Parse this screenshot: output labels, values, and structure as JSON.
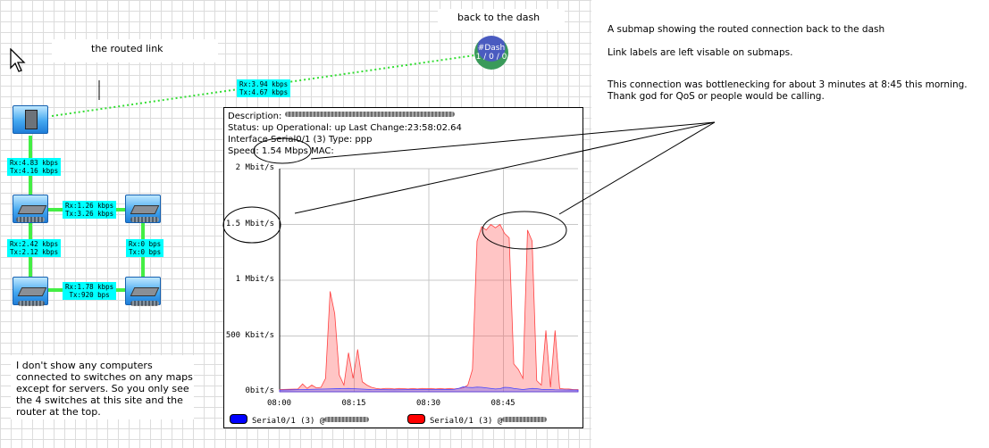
{
  "notes": {
    "routed_link": "the routed link",
    "back_to_dash": "back to the dash",
    "bottom": "I don't show any computers connected to switches on any maps except for servers.  So you only see the 4 switches at this site and the router at the top.",
    "right_1": "A submap showing the routed connection back to the dash",
    "right_2": "Link labels are left visable on submaps.",
    "right_3": "This connection was bottlenecking for about 3 minutes at 8:45 this morning.  Thank god for QoS or people would be calling."
  },
  "dash_node": {
    "name": "#Dash",
    "status": "1 / 0 / 0"
  },
  "links": {
    "routed": "Rx:3.94 kbps\nTx:4.67 kbps",
    "router_sw1": "Rx:4.83 kbps\nTx:4.16 kbps",
    "sw1_sw2": "Rx:1.26 kbps\nTx:3.26 kbps",
    "sw1_sw3": "Rx:2.42 kbps\nTx:2.12 kbps",
    "sw2_sw4": "Rx:0 bps\nTx:0 bps",
    "sw3_sw4": "Rx:1.78 kbps\nTx:920 bps"
  },
  "graph": {
    "description_label": "Description:",
    "status": "Status: up Operational: up  Last Change:23:58:02.64",
    "interface": "Interface Serial0/1 (3)   Type: ppp",
    "speed_label": "Speed:",
    "speed_value": "1.54 Mbps",
    "mac_label": "MAC:",
    "legend_blue": "Serial0/1 (3) @",
    "legend_red": "Serial0/1 (3) @"
  },
  "chart_data": {
    "type": "area",
    "x_unit": "time",
    "x_ticks": [
      "08:00",
      "08:15",
      "08:30",
      "08:45"
    ],
    "y_ticks": [
      "0bit/s",
      "500 Kbit/s",
      "1 Mbit/s",
      "1.5 Mbit/s",
      "2 Mbit/s"
    ],
    "ylim": [
      0,
      2000
    ],
    "xlim": [
      0,
      65
    ],
    "grid": true,
    "series": [
      {
        "color": "#ff4040",
        "x": [
          0,
          4,
          5,
          6,
          7,
          8,
          9,
          10,
          11,
          12,
          13,
          14,
          15,
          16,
          17,
          18,
          19,
          20,
          21,
          22,
          23,
          24,
          25,
          26,
          27,
          28,
          29,
          30,
          31,
          32,
          33,
          34,
          35,
          36,
          37,
          38,
          39,
          40,
          41,
          42,
          43,
          44,
          45,
          46,
          47,
          48,
          49,
          50,
          51,
          52,
          53,
          54,
          55,
          56,
          57,
          58,
          59,
          60,
          61,
          62,
          63,
          64,
          65
        ],
        "y": [
          20,
          25,
          70,
          30,
          60,
          35,
          40,
          120,
          900,
          700,
          150,
          60,
          350,
          120,
          380,
          90,
          60,
          40,
          30,
          25,
          30,
          30,
          25,
          30,
          28,
          25,
          30,
          25,
          30,
          28,
          30,
          25,
          30,
          25,
          30,
          25,
          30,
          35,
          60,
          200,
          1350,
          1480,
          1450,
          1500,
          1470,
          1500,
          1420,
          1380,
          250,
          200,
          120,
          1450,
          1350,
          100,
          60,
          550,
          40,
          550,
          30,
          25,
          25,
          20,
          20
        ]
      },
      {
        "color": "#4040ff",
        "x": [
          0,
          5,
          10,
          15,
          20,
          25,
          30,
          35,
          38,
          39,
          40,
          41,
          42,
          43,
          44,
          45,
          46,
          47,
          48,
          49,
          50,
          51,
          52,
          53,
          54,
          55,
          56,
          57,
          58,
          59,
          60,
          65
        ],
        "y": [
          15,
          20,
          25,
          30,
          20,
          18,
          20,
          20,
          22,
          30,
          45,
          40,
          38,
          42,
          40,
          35,
          30,
          25,
          28,
          40,
          38,
          30,
          25,
          20,
          25,
          30,
          28,
          22,
          20,
          20,
          18,
          15
        ]
      }
    ]
  }
}
